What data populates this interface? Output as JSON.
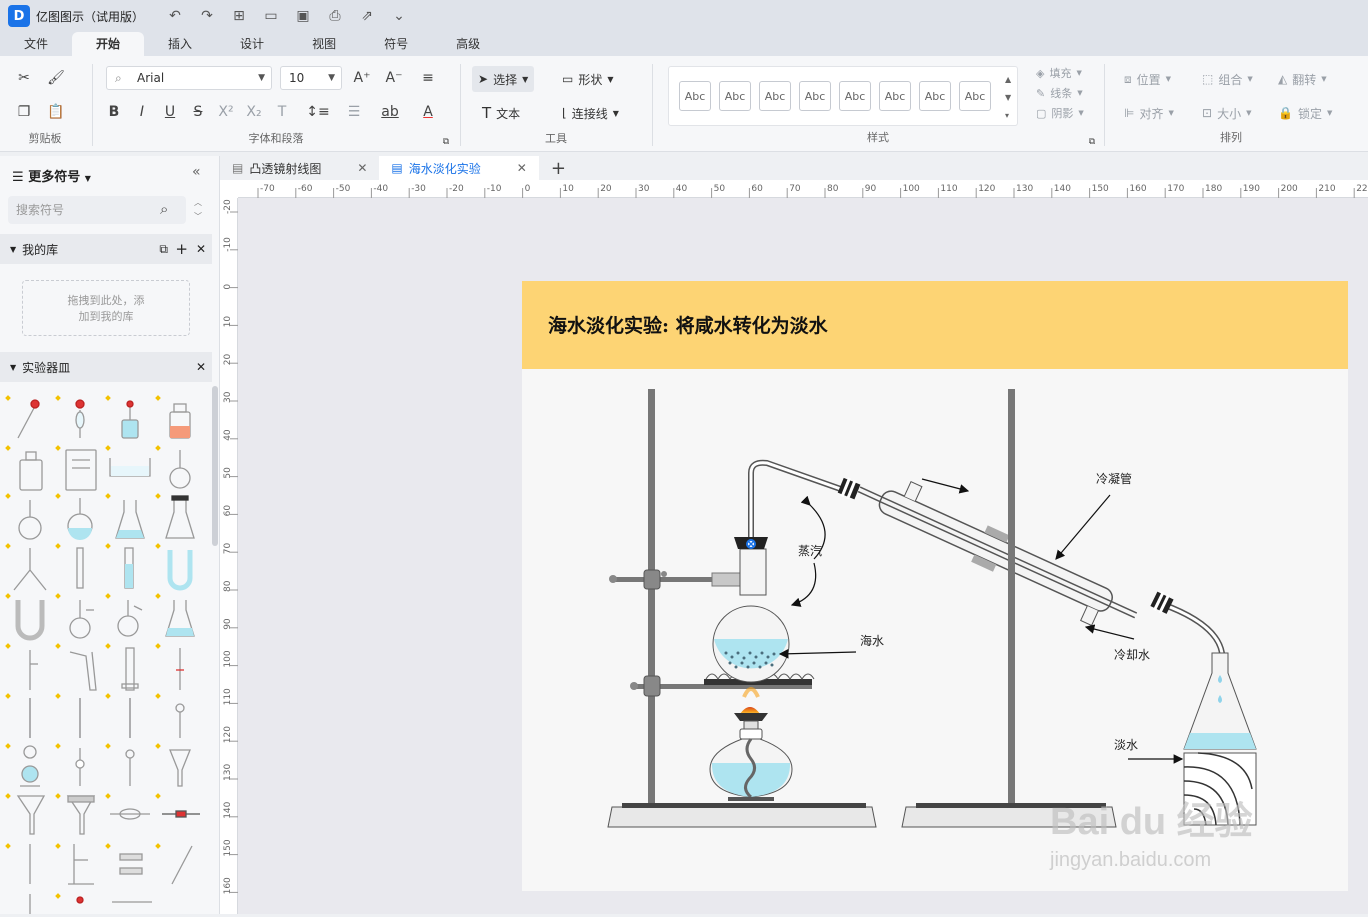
{
  "app": {
    "title": "亿图图示（试用版）",
    "logo": "D"
  },
  "menu": [
    "文件",
    "开始",
    "插入",
    "设计",
    "视图",
    "符号",
    "高级"
  ],
  "ribbon": {
    "clipboard_label": "剪贴板",
    "font_group_label": "字体和段落",
    "font_name": "Arial",
    "font_size": "10",
    "tools_label": "工具",
    "select": "选择",
    "shape": "形状",
    "text": "文本",
    "connector": "连接线",
    "styles_label": "样式",
    "style_sample": "Abc",
    "fill": "填充",
    "line": "线条",
    "shadow": "阴影",
    "arrange_label": "排列",
    "position": "位置",
    "group": "组合",
    "flip": "翻转",
    "align": "对齐",
    "size": "大小",
    "lock": "锁定"
  },
  "panel": {
    "title": "更多符号",
    "search_placeholder": "搜索符号",
    "my_library": "我的库",
    "drop_hint_1": "拖拽到此处，添",
    "drop_hint_2": "加到我的库",
    "lab_library": "实验器皿"
  },
  "tabs": [
    {
      "label": "凸透镜射线图"
    },
    {
      "label": "海水淡化实验"
    }
  ],
  "ruler": {
    "h_ticks": [
      "-70",
      "-60",
      "-50",
      "-40",
      "-30",
      "-20",
      "-10",
      "0",
      "10",
      "20",
      "30",
      "40",
      "50",
      "60",
      "70",
      "80",
      "90",
      "100",
      "110",
      "120",
      "130",
      "140",
      "150",
      "160",
      "170",
      "180",
      "190",
      "200",
      "210",
      "220"
    ],
    "v_ticks": [
      "-20",
      "-10",
      "0",
      "10",
      "20",
      "30",
      "40",
      "50",
      "60",
      "70",
      "80",
      "90",
      "100",
      "110",
      "120",
      "130",
      "140",
      "150",
      "160"
    ]
  },
  "page": {
    "title": "海水淡化实验: 将咸水转化为淡水",
    "labels": {
      "condenser": "冷凝管",
      "steam": "蒸汽",
      "seawater": "海水",
      "cooling_water": "冷却水",
      "fresh_water": "淡水"
    }
  },
  "colors": {
    "accent": "#1a73e8",
    "header": "#fdd474",
    "water": "#aee4f0"
  },
  "watermark": {
    "brand": "Bai du 经验",
    "url": "jingyan.baidu.com"
  }
}
